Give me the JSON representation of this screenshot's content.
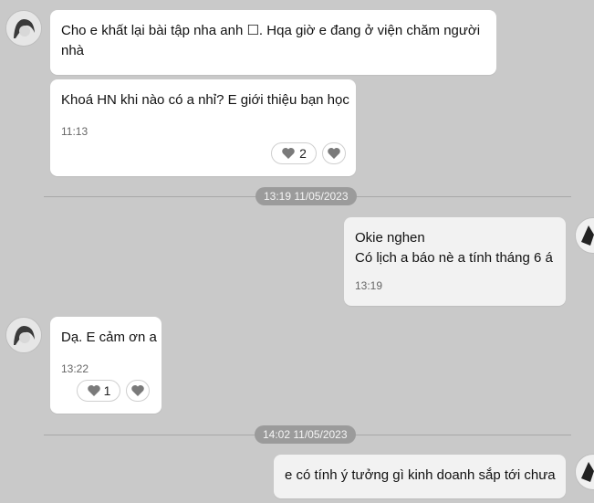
{
  "messages": [
    {
      "text_line1": "Cho e khất lại bài tập nha anh ☐. Hqa giờ e đang ở viện chăm người",
      "text_line2": "nhà"
    },
    {
      "text": "Khoá HN khi nào có a nhỉ? E giới thiệu bạn học",
      "time": "11:13",
      "reaction_count": "2"
    },
    {
      "text_line1": "Okie nghen",
      "text_line2": "Có lịch a báo nè a tính tháng 6 á",
      "time": "13:19"
    },
    {
      "text": "Dạ. E cảm ơn a",
      "time": "13:22",
      "reaction_count": "1"
    },
    {
      "text": "e có tính ý tưởng gì kinh doanh sắp tới chưa"
    }
  ],
  "separators": [
    {
      "label": "13:19 11/05/2023"
    },
    {
      "label": "14:02 11/05/2023"
    }
  ],
  "colors": {
    "background": "#c9c9c9",
    "bubble_incoming": "#ffffff",
    "bubble_outgoing": "#f2f2f2",
    "separator_pill": "#9b9b9b"
  },
  "icons": {
    "avatar_left": "avatar",
    "avatar_right": "avatar",
    "reaction": "heart-icon"
  }
}
